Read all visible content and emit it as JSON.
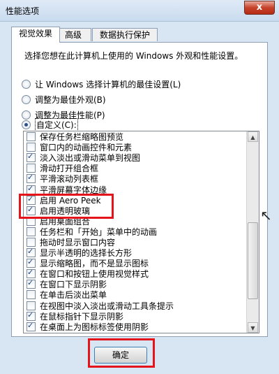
{
  "window": {
    "title": "性能选项",
    "close_label": "x"
  },
  "tabs": [
    {
      "label": "视觉效果"
    },
    {
      "label": "高级"
    },
    {
      "label": "数据执行保护"
    }
  ],
  "panel": {
    "description": "选择您想在此计算机上使用的 Windows 外观和性能设置。",
    "radios": [
      {
        "label": "让 Windows 选择计算机的最佳设置(L)",
        "checked": false
      },
      {
        "label": "调整为最佳外观(B)",
        "checked": false
      },
      {
        "label": "调整为最佳性能(P)",
        "checked": false
      },
      {
        "label": "自定义(C):",
        "checked": true
      }
    ],
    "options": [
      {
        "label": "保存任务栏缩略图预览",
        "checked": false
      },
      {
        "label": "窗口内的动画控件和元素",
        "checked": false
      },
      {
        "label": "淡入淡出或滑动菜单到视图",
        "checked": true
      },
      {
        "label": "滑动打开组合框",
        "checked": false
      },
      {
        "label": "平滑滚动列表框",
        "checked": true
      },
      {
        "label": "平滑屏幕字体边缘",
        "checked": true
      },
      {
        "label": "启用 Aero Peek",
        "checked": true
      },
      {
        "label": "启用透明玻璃",
        "checked": true
      },
      {
        "label": "启用桌面组合",
        "checked": false
      },
      {
        "label": "任务栏和「开始」菜单中的动画",
        "checked": false
      },
      {
        "label": "拖动时显示窗口内容",
        "checked": false
      },
      {
        "label": "显示半透明的选择长方形",
        "checked": true
      },
      {
        "label": "显示缩略图，而不是显示图标",
        "checked": true
      },
      {
        "label": "在窗口和按钮上使用视觉样式",
        "checked": true
      },
      {
        "label": "在窗口下显示阴影",
        "checked": true
      },
      {
        "label": "在单击后淡出菜单",
        "checked": false
      },
      {
        "label": "在视图中淡入淡出或滑动工具条提示",
        "checked": false
      },
      {
        "label": "在鼠标指针下显示阴影",
        "checked": true
      },
      {
        "label": "在桌面上为图标标签使用阴影",
        "checked": true
      }
    ]
  },
  "buttons": {
    "ok_label": "确定"
  },
  "accent": {
    "highlight_color": "#e5141a"
  },
  "icons": {
    "scroll_up": "▲",
    "scroll_down": "▼",
    "cursor": "↖"
  }
}
